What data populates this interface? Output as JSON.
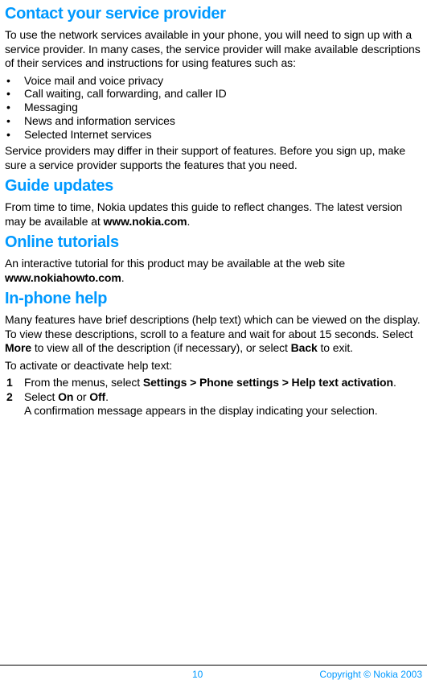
{
  "sections": {
    "contact": {
      "heading": "Contact your service provider",
      "intro": "To use the network services available in your phone, you will need to sign up with a service provider. In many cases, the service provider will make available descriptions of their services and instructions for using features such as:",
      "bullets": [
        "Voice mail and voice privacy",
        "Call waiting, call forwarding, and caller ID",
        "Messaging",
        "News and information services",
        "Selected Internet services"
      ],
      "outro": "Service providers may differ in their support of features. Before you sign up, make sure a service provider supports the features that you need."
    },
    "guide": {
      "heading": "Guide updates",
      "p1_before": "From time to time, Nokia updates this guide to reflect changes. The latest version may be available at ",
      "p1_bold": "www.nokia.com",
      "p1_after": "."
    },
    "online": {
      "heading": "Online tutorials",
      "p1_before": "An interactive tutorial for this product may be available at the web site ",
      "p1_bold": "www.nokiahowto.com",
      "p1_after": "."
    },
    "inphone": {
      "heading": "In-phone help",
      "p1_a": "Many features have brief descriptions (help text) which can be viewed on the display. To view these descriptions, scroll to a feature and wait for about 15 seconds. Select ",
      "p1_b1": "More",
      "p1_c": " to view all of the description (if necessary), or select ",
      "p1_b2": "Back",
      "p1_d": " to exit.",
      "p2": "To activate or deactivate help text:",
      "step1_a": "From the menus, select ",
      "step1_b": "Settings > Phone settings > Help text activation",
      "step1_c": ".",
      "step2_a": "Select ",
      "step2_b1": "On",
      "step2_mid": " or ",
      "step2_b2": "Off",
      "step2_c": ".",
      "step2_line2": "A confirmation message appears in the display indicating your selection."
    }
  },
  "footer": {
    "page": "10",
    "copyright": "Copyright © Nokia 2003"
  }
}
